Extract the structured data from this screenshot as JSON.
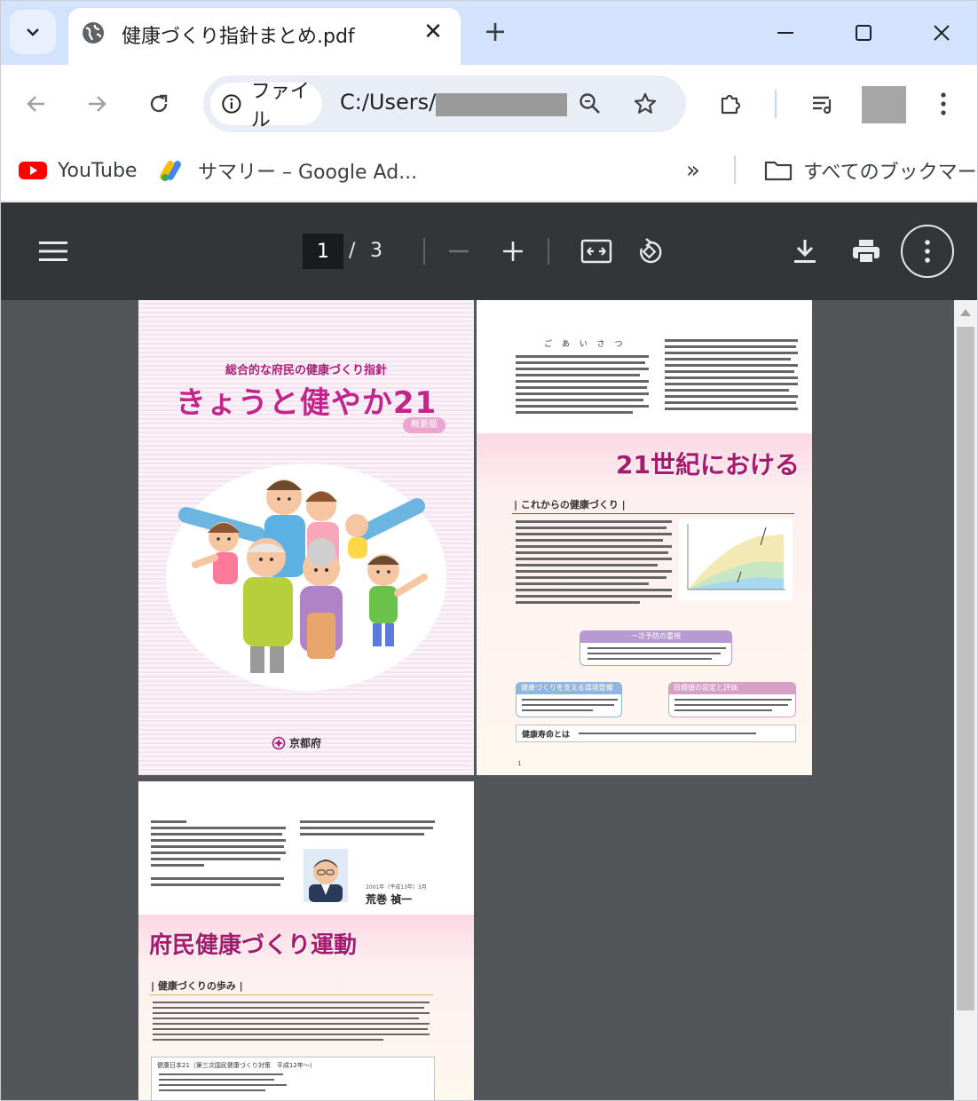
{
  "tab": {
    "title": "健康づくり指針まとめ.pdf",
    "close": "✕",
    "new_tab": "+"
  },
  "omnibox": {
    "chip_label": "ファイル",
    "url_prefix": "C:/Users/"
  },
  "bookmarks": [
    {
      "label": "YouTube",
      "icon": "youtube-icon"
    },
    {
      "label": "サマリー – Google Ad...",
      "icon": "google-ads-icon"
    }
  ],
  "bookmarks_all": "すべてのブックマーク",
  "bookmarks_overflow": "»",
  "pdf": {
    "current_page": "1",
    "slash": "/",
    "total_pages": "3"
  },
  "cover": {
    "subtitle": "総合的な府民の健康づくり指針",
    "title": "きょうと健やか21",
    "badge": "概要版",
    "publisher": "京都府"
  },
  "page2": {
    "greeting": "ご あ い さ つ",
    "heading": "21世紀における",
    "section": "| これからの健康づくり |",
    "box_prevention": "一次予防の重視",
    "box_environment": "健康づくりを支える環境整備",
    "box_goals": "目標値の設定と評価",
    "box_healthy_life": "健康寿命とは",
    "page_number": "1"
  },
  "page3": {
    "heading": "府民健康づくり運動",
    "section": "| 健康づくりの歩み |",
    "box_title": "健康日本21（第三次国民健康づくり対策　平成12年〜）",
    "signature_date": "2001年（平成13年）3月",
    "signature_name": "荒巻 禎一"
  },
  "colors": {
    "tab_strip": "#d3e3fd",
    "pdf_toolbar": "#323639",
    "viewer_bg": "#525659",
    "heading_magenta": "#a41b6e"
  }
}
